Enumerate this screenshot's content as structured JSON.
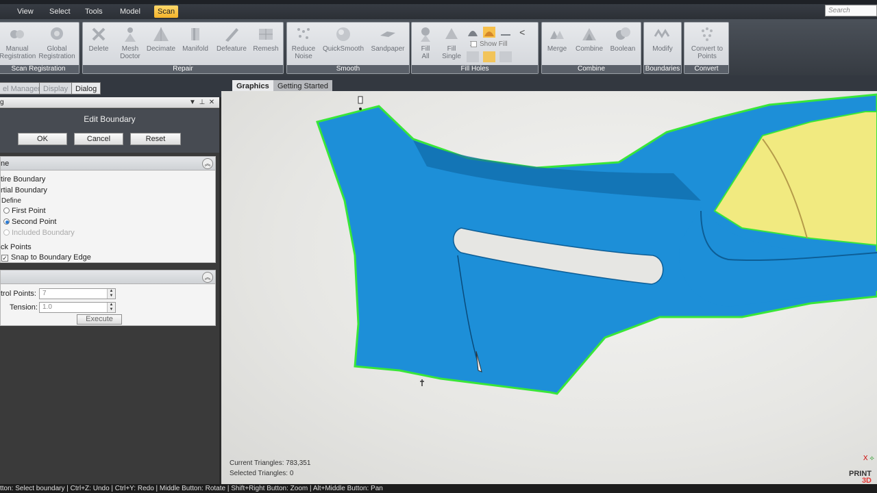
{
  "menu": {
    "items": [
      "View",
      "Select",
      "Tools",
      "Model",
      "Scan"
    ],
    "active": "Scan",
    "search_placeholder": "Search"
  },
  "ribbon": {
    "groups": {
      "scan_registration": {
        "label": "Scan Registration",
        "buttons": [
          "Manual\nRegistration",
          "Global\nRegistration"
        ]
      },
      "repair": {
        "label": "Repair",
        "buttons": [
          "Delete",
          "Mesh\nDoctor",
          "Decimate",
          "Manifold",
          "Defeature",
          "Remesh"
        ]
      },
      "smooth": {
        "label": "Smooth",
        "buttons": [
          "Reduce\nNoise",
          "QuickSmooth",
          "Sandpaper"
        ]
      },
      "fill_holes": {
        "label": "Fill Holes",
        "buttons": [
          "Fill\nAll",
          "Fill\nSingle"
        ],
        "show_fill": "Show Fill"
      },
      "combine": {
        "label": "Combine",
        "buttons": [
          "Merge",
          "Combine",
          "Boolean"
        ]
      },
      "boundaries": {
        "label": "Boundaries",
        "buttons": [
          "Modify"
        ]
      },
      "convert": {
        "label": "Convert",
        "buttons": [
          "Convert to\nPoints"
        ]
      }
    }
  },
  "panel_tabs": [
    "el Manager",
    "Display",
    "Dialog"
  ],
  "panel_tab_active": "Dialog",
  "view_tabs": [
    "Graphics",
    "Getting Started"
  ],
  "view_tab_active": "Graphics",
  "dialog": {
    "header": "g",
    "title": "Edit Boundary",
    "buttons": {
      "ok": "OK",
      "cancel": "Cancel",
      "reset": "Reset"
    },
    "define_section": {
      "head": "ne",
      "entire": "tire Boundary",
      "partial": "rtial Boundary",
      "define_legend": "Define",
      "first_point": "First Point",
      "second_point": "Second Point",
      "included_boundary": "Included Boundary",
      "selected_option": "Second Point",
      "pick_points": "ck Points",
      "snap": "Snap to Boundary Edge",
      "snap_checked": true
    },
    "params_section": {
      "control_points_label": "trol Points:",
      "control_points_value": "7",
      "tension_label": "Tension:",
      "tension_value": "1.0",
      "execute": "Execute"
    }
  },
  "viewport": {
    "current_triangles": "Current Triangles: 783,351",
    "selected_triangles": "Selected Triangles: 0",
    "axis_label": "X",
    "logo_top": "PRINT",
    "logo_bottom": "3D"
  },
  "colors": {
    "accent_tab": "#f4b32a",
    "model_blue": "#1d8fd8",
    "boundary_green": "#39e639",
    "model_yellow": "#f1ea80"
  },
  "status": "tton: Select boundary | Ctrl+Z: Undo | Ctrl+Y: Redo | Middle Button: Rotate | Shift+Right Button: Zoom | Alt+Middle Button: Pan"
}
